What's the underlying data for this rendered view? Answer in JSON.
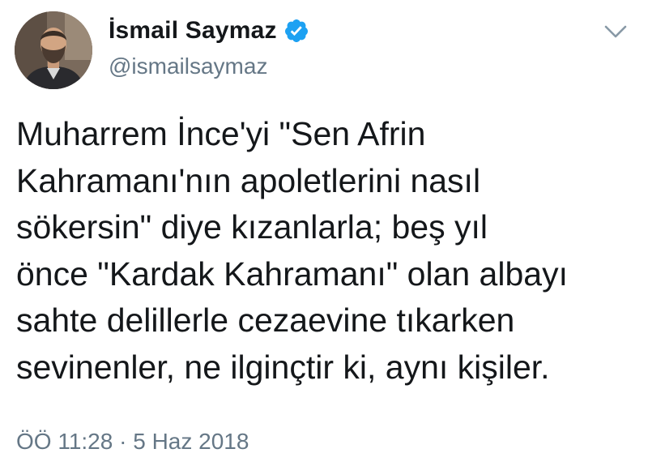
{
  "author": {
    "display_name": "İsmail Saymaz",
    "handle": "@ismailsaymaz",
    "verified": true,
    "avatar_icon": "profile-photo"
  },
  "tweet": {
    "lines": [
      "Muharrem İnce'yi \"Sen Afrin",
      "Kahramanı'nın apoletlerini nasıl",
      "sökersin\" diye kızanlarla; beş yıl",
      "önce \"Kardak Kahramanı\" olan albayı",
      "sahte delillerle cezaevine tıkarken",
      "sevinenler, ne ilginçtir ki, aynı kişiler."
    ],
    "timestamp": "ÖÖ 11:28 · 5 Haz 2018"
  },
  "icons": {
    "verified": "verified-badge-icon",
    "menu": "chevron-down-icon"
  },
  "colors": {
    "text": "#14171a",
    "secondary": "#657786",
    "verified": "#1da1f2",
    "background": "#ffffff"
  }
}
